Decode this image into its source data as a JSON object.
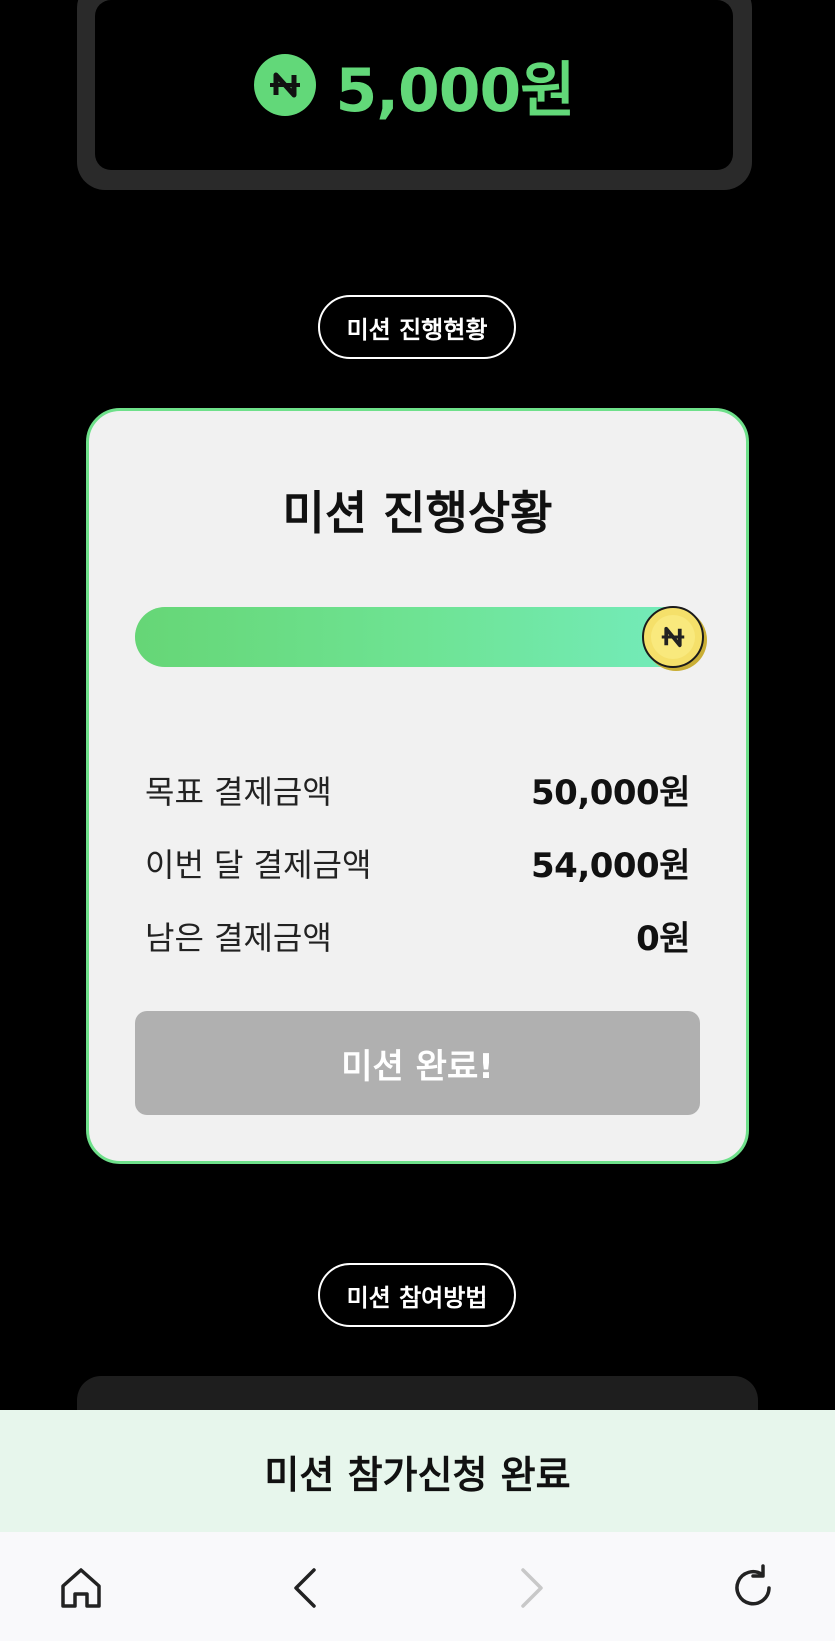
{
  "reward": {
    "amount": "5,000원",
    "icon": "n-coin-icon",
    "accent_color": "#62d879"
  },
  "section_pills": {
    "progress": "미션 진행현황",
    "how_to": "미션 참여방법"
  },
  "status_card": {
    "title": "미션 진행상황",
    "progress_fraction": 1.0,
    "progress_icon": "gold-n-coin-icon",
    "rows": [
      {
        "label": "목표 결제금액",
        "value": "50,000원"
      },
      {
        "label": "이번 달 결제금액",
        "value": "54,000원"
      },
      {
        "label": "남은 결제금액",
        "value": "0원"
      }
    ],
    "complete_button": "미션 완료!",
    "border_color": "#6ee08a"
  },
  "banner": {
    "text": "미션 참가신청 완료"
  },
  "browser_nav": {
    "home_icon": "home-icon",
    "back_icon": "chevron-left-icon",
    "forward_icon": "chevron-right-icon",
    "reload_icon": "reload-icon"
  }
}
